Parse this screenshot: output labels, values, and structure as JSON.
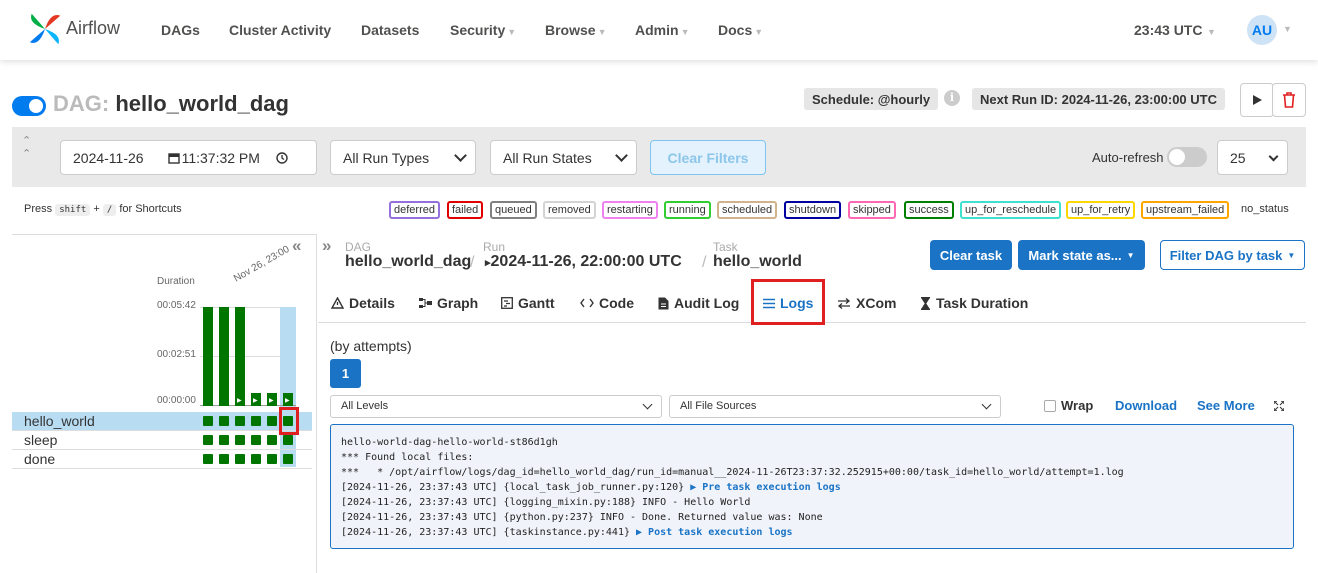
{
  "nav": {
    "brand": "Airflow",
    "items": [
      "DAGs",
      "Cluster Activity",
      "Datasets",
      "Security",
      "Browse",
      "Admin",
      "Docs"
    ],
    "time": "23:43 UTC",
    "avatar": "AU",
    "colors": {
      "accent": "#017cee",
      "brand_text": "#51504f"
    }
  },
  "dag": {
    "prefix": "DAG:",
    "name": "hello_world_dag",
    "schedule": "Schedule: @hourly",
    "next_run": "Next Run ID: 2024-11-26, 23:00:00 UTC"
  },
  "filters": {
    "date": "2024-11-26",
    "time": "11:37:32 PM",
    "run_types": "All Run Types",
    "run_states": "All Run States",
    "clear_label": "Clear Filters",
    "autorefresh_label": "Auto-refresh",
    "page_size": "25"
  },
  "shortcuts": {
    "press": "Press",
    "shift": "shift",
    "plus": "+",
    "slash": "/",
    "suffix": "for Shortcuts"
  },
  "legend": [
    {
      "label": "deferred",
      "color": "#9370db"
    },
    {
      "label": "failed",
      "color": "#e00000"
    },
    {
      "label": "queued",
      "color": "#808080"
    },
    {
      "label": "removed",
      "color": "#d3d3d3"
    },
    {
      "label": "restarting",
      "color": "#ee82ee"
    },
    {
      "label": "running",
      "color": "#32cd32"
    },
    {
      "label": "scheduled",
      "color": "#d2b48c"
    },
    {
      "label": "shutdown",
      "color": "#0000a0"
    },
    {
      "label": "skipped",
      "color": "#ff69b4"
    },
    {
      "label": "success",
      "color": "#008000"
    },
    {
      "label": "up_for_reschedule",
      "color": "#40e0d0"
    },
    {
      "label": "up_for_retry",
      "color": "#ffd700"
    },
    {
      "label": "upstream_failed",
      "color": "#ffa500"
    }
  ],
  "legend_plain": "no_status",
  "grid": {
    "duration_label": "Duration",
    "ticks": [
      "00:05:42",
      "00:02:51",
      "00:00:00"
    ],
    "date_label": "Nov 26, 23:00",
    "tasks": [
      "hello_world",
      "sleep",
      "done"
    ]
  },
  "breadcrumb": {
    "dag_label": "DAG",
    "dag_value": "hello_world_dag",
    "run_label": "Run",
    "run_value": "2024-11-26, 22:00:00 UTC",
    "task_label": "Task",
    "task_value": "hello_world",
    "run_icon": "play-icon"
  },
  "actions": {
    "clear_task": "Clear task",
    "mark_state": "Mark state as...",
    "filter_dag": "Filter DAG by task"
  },
  "tabs": [
    {
      "label": "Details",
      "icon": "warning-icon"
    },
    {
      "label": "Graph",
      "icon": "graph-icon"
    },
    {
      "label": "Gantt",
      "icon": "gantt-icon"
    },
    {
      "label": "Code",
      "icon": "code-icon"
    },
    {
      "label": "Audit Log",
      "icon": "document-icon"
    },
    {
      "label": "Logs",
      "icon": "list-icon"
    },
    {
      "label": "XCom",
      "icon": "arrows-icon"
    },
    {
      "label": "Task Duration",
      "icon": "hourglass-icon"
    }
  ],
  "logs": {
    "attempts_label": "(by attempts)",
    "attempt": "1",
    "levels": "All Levels",
    "sources": "All File Sources",
    "wrap": "Wrap",
    "download": "Download",
    "see_more": "See More",
    "lines": [
      {
        "text": "hello-world-dag-hello-world-st86d1gh",
        "link": ""
      },
      {
        "text": "*** Found local files:",
        "link": ""
      },
      {
        "text": "***   * /opt/airflow/logs/dag_id=hello_world_dag/run_id=manual__2024-11-26T23:37:32.252915+00:00/task_id=hello_world/attempt=1.log",
        "link": ""
      },
      {
        "text": "[2024-11-26, 23:37:43 UTC] {local_task_job_runner.py:120} ",
        "link": "▶ Pre task execution logs"
      },
      {
        "text": "[2024-11-26, 23:37:43 UTC] {logging_mixin.py:188} INFO - Hello World",
        "link": ""
      },
      {
        "text": "[2024-11-26, 23:37:43 UTC] {python.py:237} INFO - Done. Returned value was: None",
        "link": ""
      },
      {
        "text": "[2024-11-26, 23:37:43 UTC] {taskinstance.py:441} ",
        "link": "▶ Post task execution logs"
      }
    ]
  }
}
